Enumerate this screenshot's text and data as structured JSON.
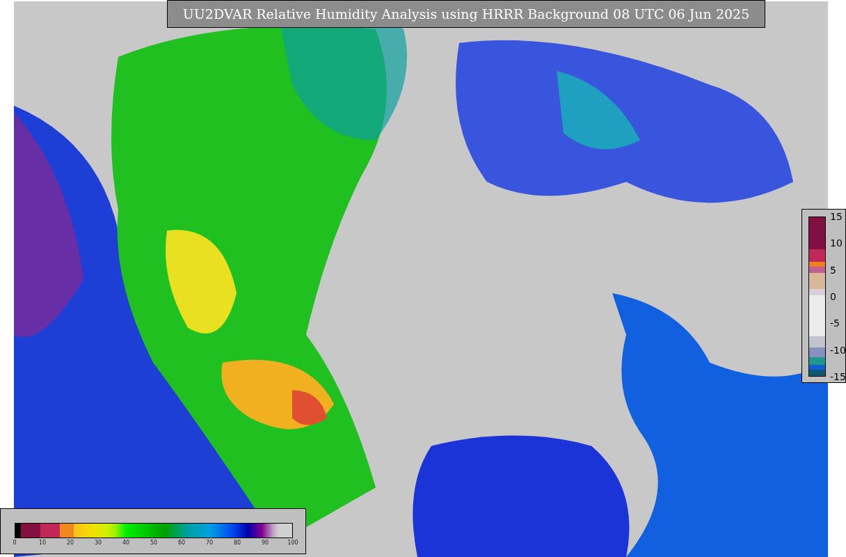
{
  "title": "UU2DVAR Relative Humidity Analysis using HRRR Background 08 UTC 06 Jun 2025",
  "humidity_colorbar": {
    "ticks": [
      "0",
      "10",
      "20",
      "30",
      "40",
      "50",
      "60",
      "70",
      "80",
      "90",
      "100"
    ]
  },
  "difference_colorbar": {
    "ticks": [
      "15",
      "10",
      "5",
      "0",
      "-5",
      "-10",
      "-15"
    ]
  }
}
